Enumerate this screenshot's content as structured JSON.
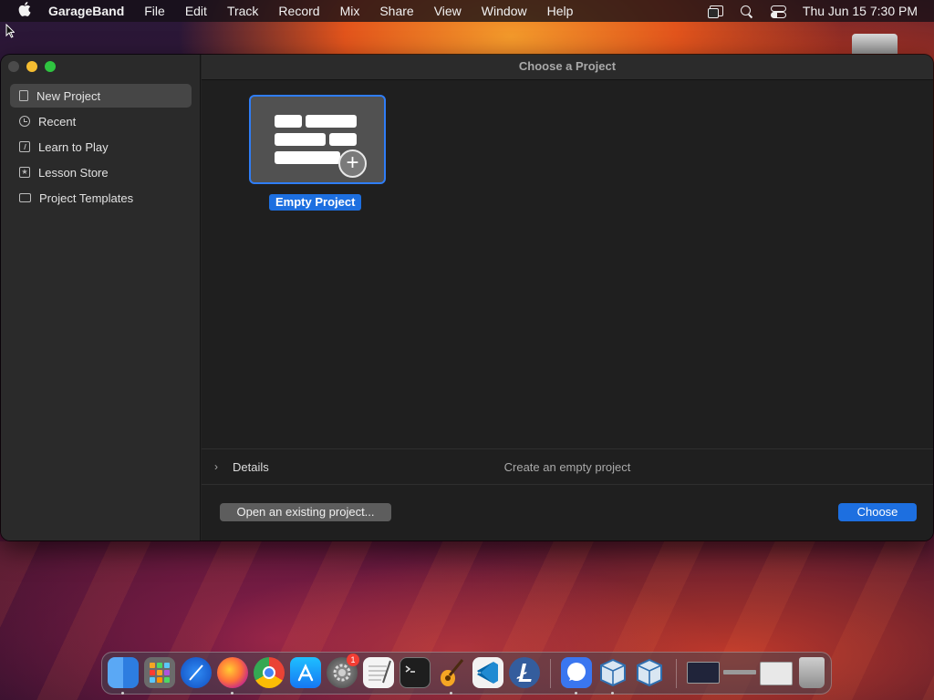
{
  "menubar": {
    "apple_icon": "apple-logo",
    "app_name": "GarageBand",
    "menus": [
      "File",
      "Edit",
      "Track",
      "Record",
      "Mix",
      "Share",
      "View",
      "Window",
      "Help"
    ],
    "status_icons": [
      "screen-mirroring-icon",
      "spotlight-search-icon",
      "control-center-icon"
    ],
    "clock": "Thu Jun 15  7:30 PM"
  },
  "window": {
    "title": "Choose a Project",
    "sidebar": {
      "items": [
        {
          "label": "New Project",
          "icon": "document-icon",
          "selected": true
        },
        {
          "label": "Recent",
          "icon": "clock-icon",
          "selected": false
        },
        {
          "label": "Learn to Play",
          "icon": "music-book-icon",
          "selected": false
        },
        {
          "label": "Lesson Store",
          "icon": "star-icon",
          "selected": false
        },
        {
          "label": "Project Templates",
          "icon": "folder-icon",
          "selected": false
        }
      ]
    },
    "project_tile": {
      "label": "Empty Project",
      "icon": "plus-icon"
    },
    "details": {
      "label": "Details",
      "description": "Create an empty project"
    },
    "buttons": {
      "open_existing": "Open an existing project...",
      "choose": "Choose"
    }
  },
  "dock": {
    "apps": [
      {
        "name": "Finder",
        "icon": "finder-icon",
        "running": true
      },
      {
        "name": "Launchpad",
        "icon": "launchpad-icon",
        "running": false
      },
      {
        "name": "Safari",
        "icon": "safari-icon",
        "running": false
      },
      {
        "name": "Firefox",
        "icon": "firefox-icon",
        "running": true
      },
      {
        "name": "Chrome",
        "icon": "chrome-icon",
        "running": false
      },
      {
        "name": "App Store",
        "icon": "app-store-icon",
        "running": false
      },
      {
        "name": "System Settings",
        "icon": "system-settings-icon",
        "running": false,
        "badge": "1"
      },
      {
        "name": "TextEdit",
        "icon": "textedit-icon",
        "running": false
      },
      {
        "name": "Terminal",
        "icon": "terminal-icon",
        "running": false
      },
      {
        "name": "GarageBand",
        "icon": "garageband-icon",
        "running": true
      },
      {
        "name": "VS Code",
        "icon": "vscode-icon",
        "running": false
      },
      {
        "name": "Litecoin",
        "icon": "litecoin-icon",
        "running": false
      },
      {
        "name": "Signal",
        "icon": "signal-icon",
        "running": true
      },
      {
        "name": "VirtualBox",
        "icon": "virtualbox-icon",
        "running": true
      },
      {
        "name": "VirtualBox VM",
        "icon": "virtualbox-vm-icon",
        "running": true
      },
      {
        "name": "Recent Item 1",
        "icon": "recent-window-icon",
        "running": false
      },
      {
        "name": "Recent Item 2",
        "icon": "recent-window-icon",
        "running": false
      },
      {
        "name": "Recent Item 3",
        "icon": "recent-window-icon",
        "running": false
      },
      {
        "name": "Trash",
        "icon": "trash-icon",
        "running": false
      }
    ]
  },
  "colors": {
    "accent": "#1d6fe0",
    "tile_border": "#2f7df6",
    "traffic_min": "#f5bd31",
    "traffic_max": "#2fc440"
  }
}
